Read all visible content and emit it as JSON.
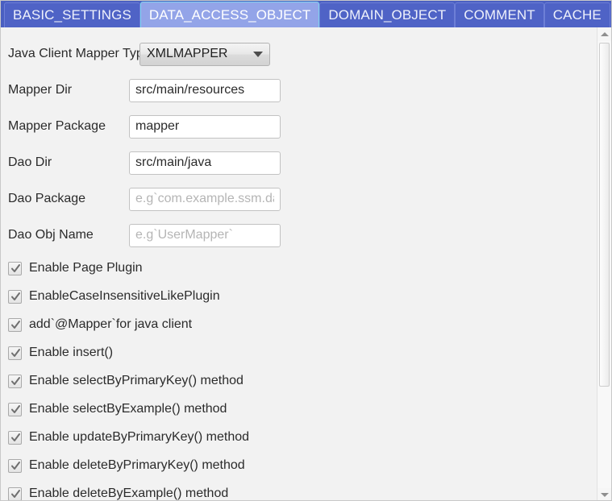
{
  "window": {
    "background_color": "#f2f2f2",
    "tabbar_color": "#4a5fc1"
  },
  "tabs": [
    {
      "label": "BASIC_SETTINGS",
      "active": false
    },
    {
      "label": "DATA_ACCESS_OBJECT",
      "active": true
    },
    {
      "label": "DOMAIN_OBJECT",
      "active": false
    },
    {
      "label": "COMMENT",
      "active": false
    },
    {
      "label": "CACHE",
      "active": false
    }
  ],
  "form": {
    "mapper_type": {
      "label": "Java Client Mapper Type",
      "value": "XMLMAPPER",
      "arrow_icon": "chevron-down-icon"
    },
    "fields": [
      {
        "label": "Mapper Dir",
        "value": "src/main/resources",
        "placeholder": ""
      },
      {
        "label": "Mapper Package",
        "value": "mapper",
        "placeholder": ""
      },
      {
        "label": "Dao Dir",
        "value": "src/main/java",
        "placeholder": ""
      },
      {
        "label": "Dao Package",
        "value": "",
        "placeholder": "e.g`com.example.ssm.dao"
      },
      {
        "label": "Dao Obj Name",
        "value": "",
        "placeholder": "e.g`UserMapper`"
      }
    ]
  },
  "checkboxes": [
    {
      "label": "Enable Page Plugin",
      "checked": true
    },
    {
      "label": "EnableCaseInsensitiveLikePlugin",
      "checked": true
    },
    {
      "label": "add`@Mapper`for java client",
      "checked": true
    },
    {
      "label": "Enable insert()",
      "checked": true
    },
    {
      "label": "Enable selectByPrimaryKey() method",
      "checked": true
    },
    {
      "label": "Enable selectByExample() method",
      "checked": true
    },
    {
      "label": "Enable updateByPrimaryKey() method",
      "checked": true
    },
    {
      "label": "Enable deleteByPrimaryKey() method",
      "checked": true
    },
    {
      "label": "Enable deleteByExample() method",
      "checked": true
    }
  ],
  "scrollbar": {
    "up_arrow_icon": "chevron-up-icon",
    "down_arrow_icon": "chevron-down-icon"
  }
}
